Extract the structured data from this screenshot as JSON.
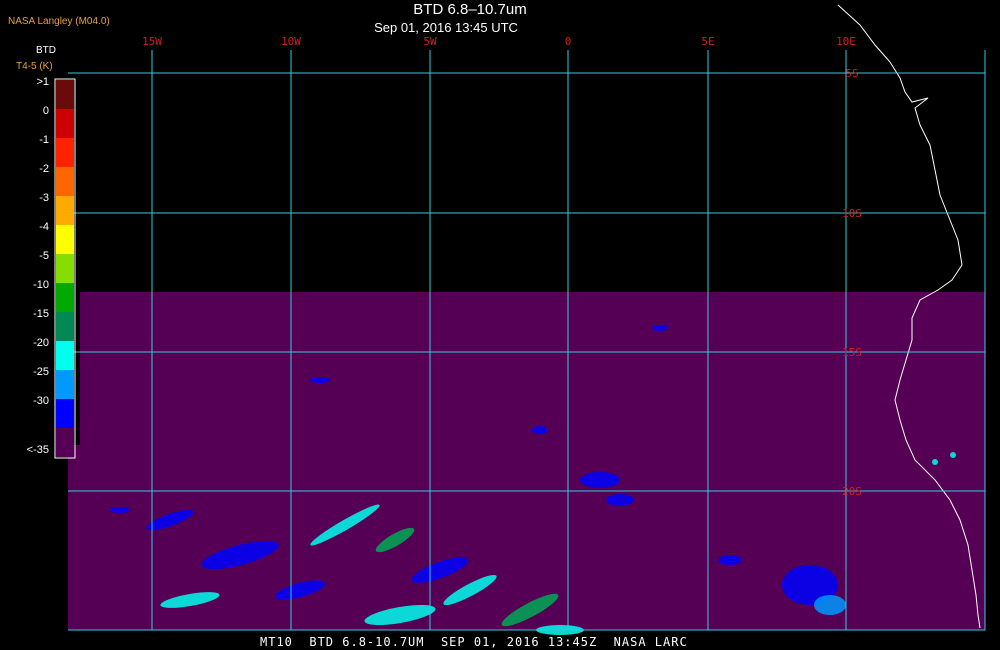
{
  "credit": "NASA Langley (M04.0)",
  "title": "BTD 6.8–10.7um",
  "subtitle": "Sep 01, 2016 13:45 UTC",
  "footer": "MT10  BTD 6.8-10.7UM  SEP 01, 2016 13:45Z  NASA LARC",
  "legend": {
    "title": "BTD",
    "subtitle": "T4-5 (K)",
    "bins": [
      {
        "label": ">1",
        "color": "#6b0a0a"
      },
      {
        "label": "0",
        "color": "#cc0000"
      },
      {
        "label": "-1",
        "color": "#ff2200"
      },
      {
        "label": "-2",
        "color": "#ff6600"
      },
      {
        "label": "-3",
        "color": "#ffaa00"
      },
      {
        "label": "-4",
        "color": "#ffff00"
      },
      {
        "label": "-5",
        "color": "#88dd00"
      },
      {
        "label": "-10",
        "color": "#00aa00"
      },
      {
        "label": "-15",
        "color": "#008855"
      },
      {
        "label": "-20",
        "color": "#00ffee"
      },
      {
        "label": "-25",
        "color": "#0099ff"
      },
      {
        "label": "-30",
        "color": "#0000ff"
      },
      {
        "label": "<-35",
        "color": "#550055"
      }
    ]
  },
  "map": {
    "background_color": "#550055",
    "grid_color": "#33ccdd",
    "label_color": "#cc2222",
    "coast_color": "#ffffff",
    "longitudes": [
      "15W",
      "10W",
      "5W",
      "0",
      "5E",
      "10E"
    ],
    "latitudes": [
      "5S",
      "10S",
      "15S",
      "20S"
    ]
  }
}
